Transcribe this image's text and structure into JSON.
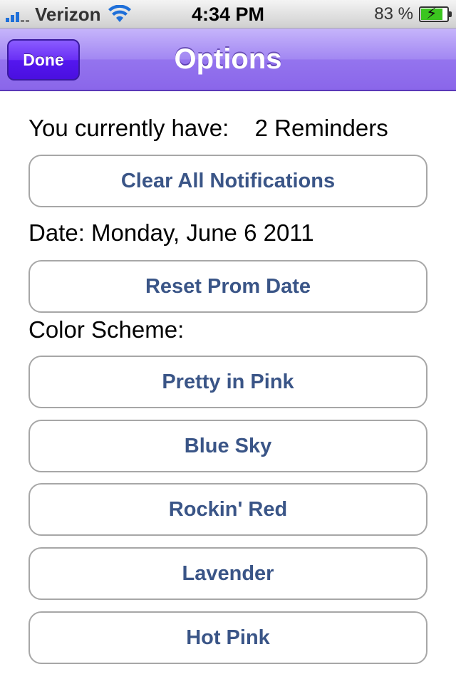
{
  "status_bar": {
    "carrier": "Verizon",
    "time": "4:34 PM",
    "battery_percent": "83 %",
    "battery_level": 0.83,
    "signal_icon": "signal-bars-icon",
    "wifi_icon": "wifi-icon",
    "battery_icon": "battery-charging-icon"
  },
  "nav": {
    "title": "Options",
    "done_label": "Done",
    "accent_color": "#9474ee"
  },
  "reminders": {
    "label": "You currently have:",
    "value": "2 Reminders"
  },
  "clear_button_label": "Clear All Notifications",
  "date": {
    "label": "Date:",
    "value": "Monday, June 6 2011"
  },
  "reset_button_label": "Reset Prom Date",
  "color_scheme": {
    "label": "Color Scheme:",
    "options": [
      "Pretty in Pink",
      "Blue Sky",
      "Rockin' Red",
      "Lavender",
      "Hot Pink"
    ]
  },
  "button_text_color": "#3a5587"
}
